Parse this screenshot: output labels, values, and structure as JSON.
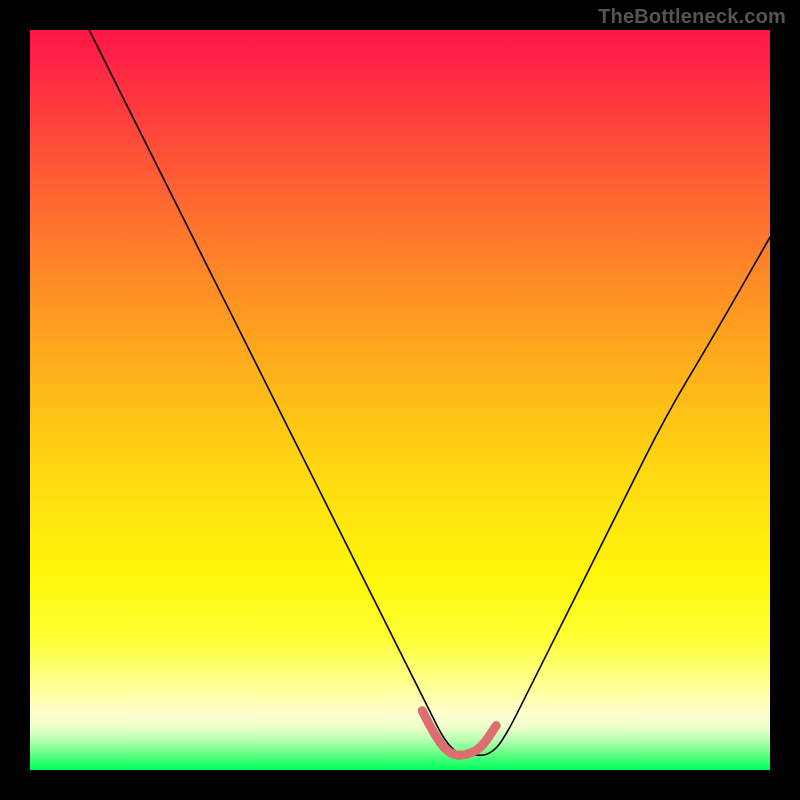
{
  "watermark": "TheBottleneck.com",
  "chart_data": {
    "type": "line",
    "title": "",
    "xlabel": "",
    "ylabel": "",
    "xlim": [
      0,
      100
    ],
    "ylim": [
      0,
      100
    ],
    "grid": false,
    "legend": false,
    "series": [
      {
        "name": "bottleneck-curve",
        "x": [
          8,
          12,
          18,
          24,
          30,
          36,
          42,
          48,
          52,
          54,
          56,
          58,
          60,
          62,
          64,
          68,
          74,
          80,
          86,
          92,
          100
        ],
        "y": [
          100,
          92,
          80,
          68,
          56,
          44,
          32,
          20,
          12,
          8,
          4,
          2,
          2,
          2,
          4,
          12,
          24,
          36,
          48,
          58,
          72
        ]
      }
    ],
    "highlight_segment": {
      "name": "valley-highlight",
      "x": [
        53,
        55,
        57,
        59,
        61,
        63
      ],
      "y": [
        8,
        4,
        2,
        2,
        3,
        6
      ],
      "color": "#db6e6e"
    },
    "background_gradient": {
      "orientation": "vertical",
      "stops": [
        {
          "pos": 0.0,
          "color": "#ff1549"
        },
        {
          "pos": 0.35,
          "color": "#ff8e25"
        },
        {
          "pos": 0.65,
          "color": "#ffe40e"
        },
        {
          "pos": 0.92,
          "color": "#ffffd0"
        },
        {
          "pos": 1.0,
          "color": "#00ff5a"
        }
      ]
    }
  }
}
